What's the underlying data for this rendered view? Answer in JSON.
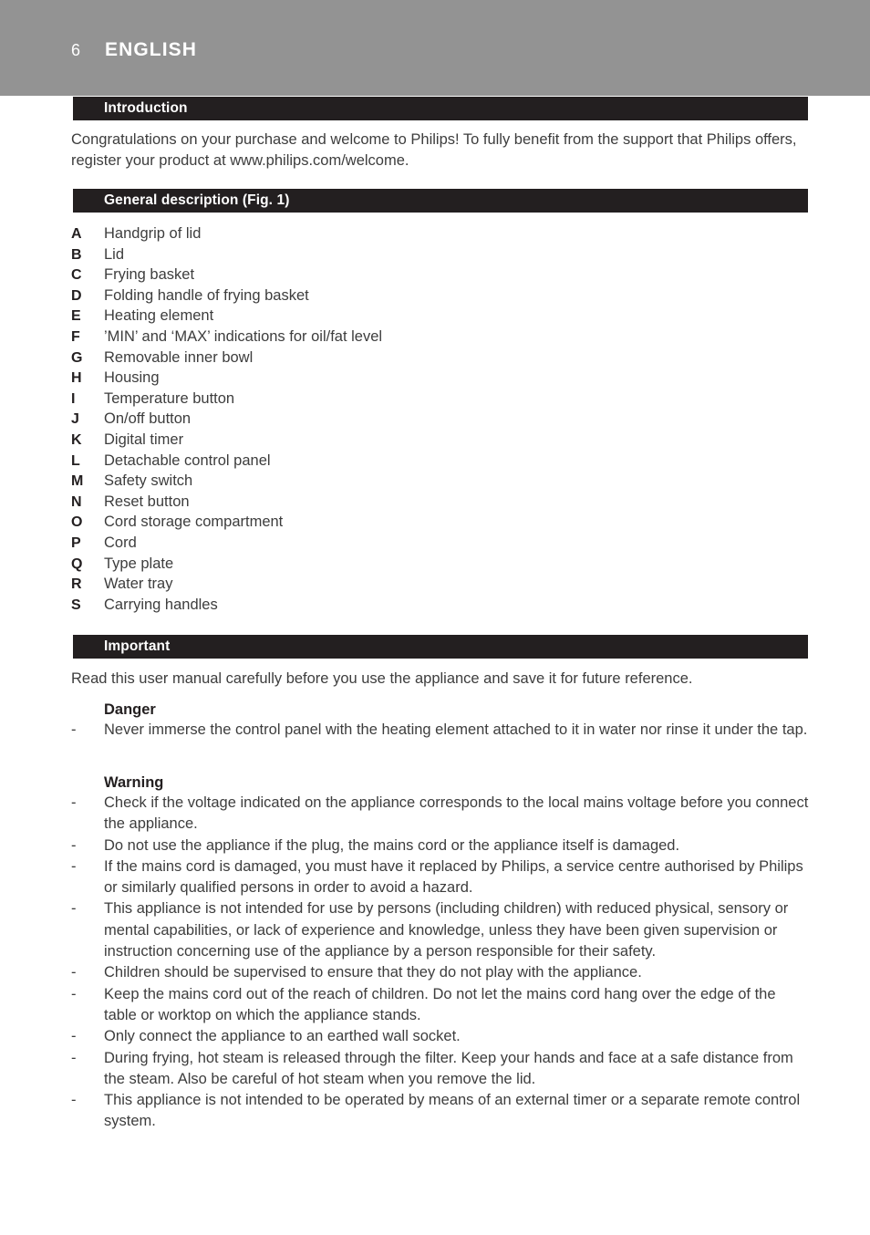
{
  "header": {
    "page_number": "6",
    "title": "ENGLISH",
    "band_color": "#939393",
    "text_color": "#ffffff"
  },
  "theme": {
    "bar_color": "#231f20",
    "body_text_color": "#3d3d3d",
    "heading_text_color": "#231f20",
    "page_background": "#ffffff"
  },
  "sections": {
    "introduction": {
      "bar_label": "Introduction",
      "paragraph": "Congratulations on your purchase and welcome to Philips! To fully benefit from the support that Philips offers, register your product at www.philips.com/welcome."
    },
    "general_description": {
      "bar_label": "General description (Fig. 1)",
      "items": [
        {
          "letter": "A",
          "text": "Handgrip of lid"
        },
        {
          "letter": "B",
          "text": "Lid"
        },
        {
          "letter": "C",
          "text": "Frying basket"
        },
        {
          "letter": "D",
          "text": "Folding handle of frying basket"
        },
        {
          "letter": "E",
          "text": "Heating element"
        },
        {
          "letter": "F",
          "text": "’MIN’ and ‘MAX’ indications for oil/fat level"
        },
        {
          "letter": "G",
          "text": "Removable inner bowl"
        },
        {
          "letter": "H",
          "text": "Housing"
        },
        {
          "letter": "I",
          "text": "Temperature button"
        },
        {
          "letter": "J",
          "text": "On/off button"
        },
        {
          "letter": "K",
          "text": "Digital timer"
        },
        {
          "letter": "L",
          "text": "Detachable control panel"
        },
        {
          "letter": "M",
          "text": "Safety switch"
        },
        {
          "letter": "N",
          "text": "Reset button"
        },
        {
          "letter": "O",
          "text": "Cord storage compartment"
        },
        {
          "letter": "P",
          "text": "Cord"
        },
        {
          "letter": "Q",
          "text": "Type plate"
        },
        {
          "letter": "R",
          "text": "Water tray"
        },
        {
          "letter": "S",
          "text": "Carrying handles"
        }
      ]
    },
    "important": {
      "bar_label": "Important",
      "paragraph": "Read this user manual carefully before you use the appliance and save it for future reference.",
      "danger": {
        "heading": "Danger",
        "bullet_mark": "-",
        "bullets": [
          "Never immerse the control panel with the heating element attached to it in water nor rinse it under the tap."
        ]
      },
      "warning": {
        "heading": "Warning",
        "bullet_mark": "-",
        "bullets": [
          "Check if the voltage indicated on the appliance corresponds to the local mains voltage before you connect the appliance.",
          "Do not use the appliance if the plug, the mains cord or the appliance itself is damaged.",
          "If the mains cord is damaged, you must have it replaced by Philips, a service centre authorised by Philips or similarly qualified persons in order to avoid a hazard.",
          "This appliance is not intended for use by persons (including children) with reduced physical, sensory or mental capabilities, or lack of experience and knowledge, unless they have been given supervision or instruction concerning use of the appliance by a person responsible for their safety.",
          "Children should be supervised to ensure that they do not play with the appliance.",
          "Keep the mains cord out of the reach of children. Do not let the mains cord hang over the edge of the table or worktop on which the appliance stands.",
          "Only connect the appliance to an earthed wall socket.",
          "During frying, hot steam is released through the filter. Keep your hands and face at a safe distance from the steam. Also be careful of hot steam when you remove the lid.",
          "This appliance is not intended to be operated by means of an external timer or a separate remote control system."
        ]
      }
    }
  }
}
